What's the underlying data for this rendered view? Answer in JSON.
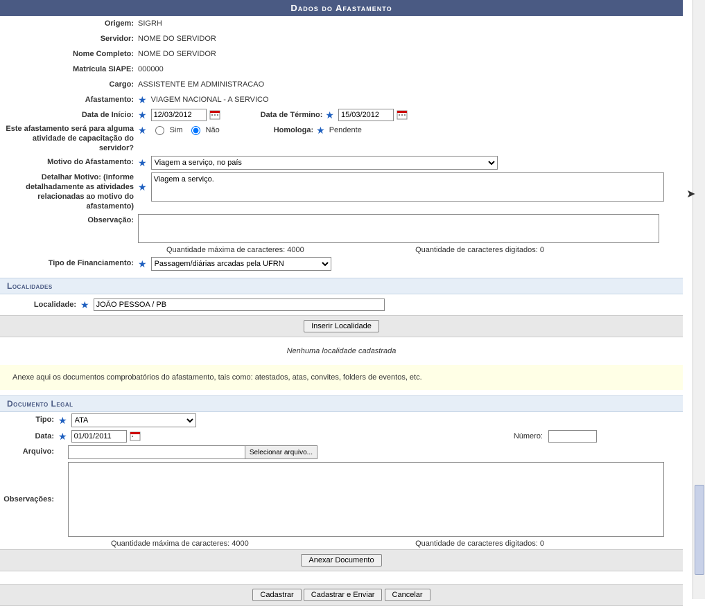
{
  "header": {
    "title": "Dados do Afastamento"
  },
  "fields": {
    "origem_label": "Origem:",
    "origem_value": "SIGRH",
    "servidor_label": "Servidor:",
    "servidor_value": "NOME DO SERVIDOR",
    "nome_label": "Nome Completo:",
    "nome_value": "NOME DO SERVIDOR",
    "matricula_label": "Matrícula SIAPE:",
    "matricula_value": "000000",
    "cargo_label": "Cargo:",
    "cargo_value": "ASSISTENTE EM ADMINISTRACAO",
    "afastamento_label": "Afastamento:",
    "afastamento_value": "VIAGEM NACIONAL - A SERVICO",
    "data_inicio_label": "Data de Início:",
    "data_inicio_value": "12/03/2012",
    "data_termino_label": "Data de Término:",
    "data_termino_value": "15/03/2012",
    "capacitacao_label": "Este afastamento será para alguma atividade de capacitação do servidor?",
    "sim_label": "Sim",
    "nao_label": "Não",
    "homologa_label": "Homologa:",
    "homologa_value": "Pendente",
    "motivo_label": "Motivo do Afastamento:",
    "motivo_value": "Viagem a serviço, no país",
    "detalhar_label": "Detalhar Motivo: (informe detalhadamente as atividades relacionadas ao motivo do afastamento)",
    "detalhar_value": "Viagem a serviço.",
    "observacao_label": "Observação:",
    "max_chars_label": "Quantidade máxima de caracteres: 4000",
    "typed_chars_label": "Quantidade de caracteres digitados: 0",
    "financiamento_label": "Tipo de Financiamento:",
    "financiamento_value": "Passagem/diárias arcadas pela UFRN"
  },
  "localidades": {
    "title": "Localidades",
    "localidade_label": "Localidade:",
    "localidade_value": "JOÃO PESSOA / PB",
    "inserir_btn": "Inserir Localidade",
    "empty_msg": "Nenhuma localidade cadastrada"
  },
  "note": "Anexe aqui os documentos comprobatórios do afastamento, tais como: atestados, atas, convites, folders de eventos, etc.",
  "documento": {
    "title": "Documento Legal",
    "tipo_label": "Tipo:",
    "tipo_value": "ATA",
    "data_label": "Data:",
    "data_value": "01/01/2011",
    "numero_label": "Número:",
    "arquivo_label": "Arquivo:",
    "selecionar_btn": "Selecionar arquivo...",
    "observacoes_label": "Observações:",
    "anexar_btn": "Anexar Documento"
  },
  "actions": {
    "cadastrar": "Cadastrar",
    "cadastrar_enviar": "Cadastrar e Enviar",
    "cancelar": "Cancelar"
  },
  "star": "★"
}
